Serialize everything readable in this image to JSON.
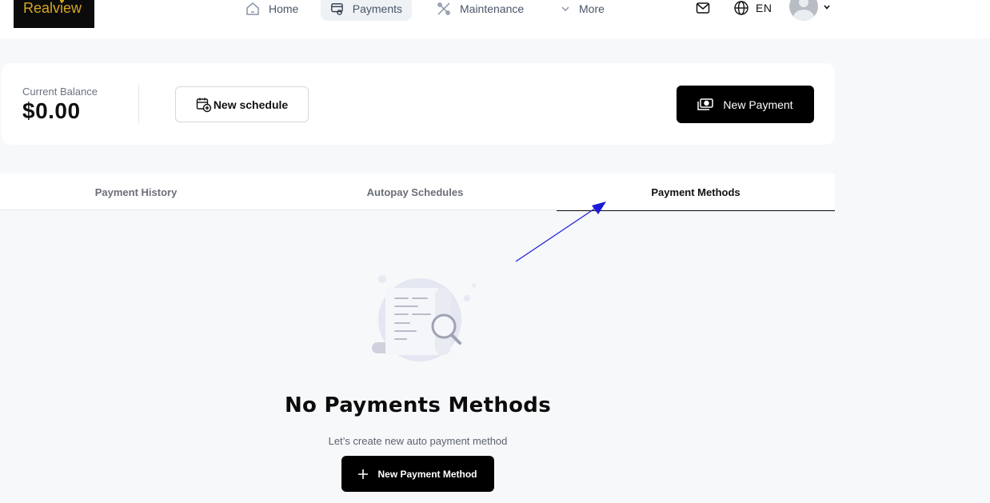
{
  "brand": {
    "logo_text": "Realview",
    "logo_color": "#d8a71f"
  },
  "nav": {
    "items": [
      {
        "label": "Home",
        "icon": "home-icon"
      },
      {
        "label": "Payments",
        "icon": "payments-icon",
        "active": true
      },
      {
        "label": "Maintenance",
        "icon": "tools-icon"
      },
      {
        "label": "More",
        "icon": "chevron-down-icon"
      }
    ],
    "language": "EN"
  },
  "balance": {
    "label": "Current Balance",
    "value": "$0.00",
    "new_schedule_label": "New schedule",
    "new_payment_label": "New Payment"
  },
  "tabs": [
    {
      "label": "Payment History"
    },
    {
      "label": "Autopay Schedules"
    },
    {
      "label": "Payment Methods",
      "active": true
    }
  ],
  "empty_state": {
    "title": "No Payments Methods",
    "subtitle": "Let’s create new auto payment method",
    "button_label": "New Payment Method",
    "button_icon": "plus-icon"
  },
  "colors": {
    "primary_button": "#000000",
    "annotation_arrow": "#1a1adb"
  }
}
